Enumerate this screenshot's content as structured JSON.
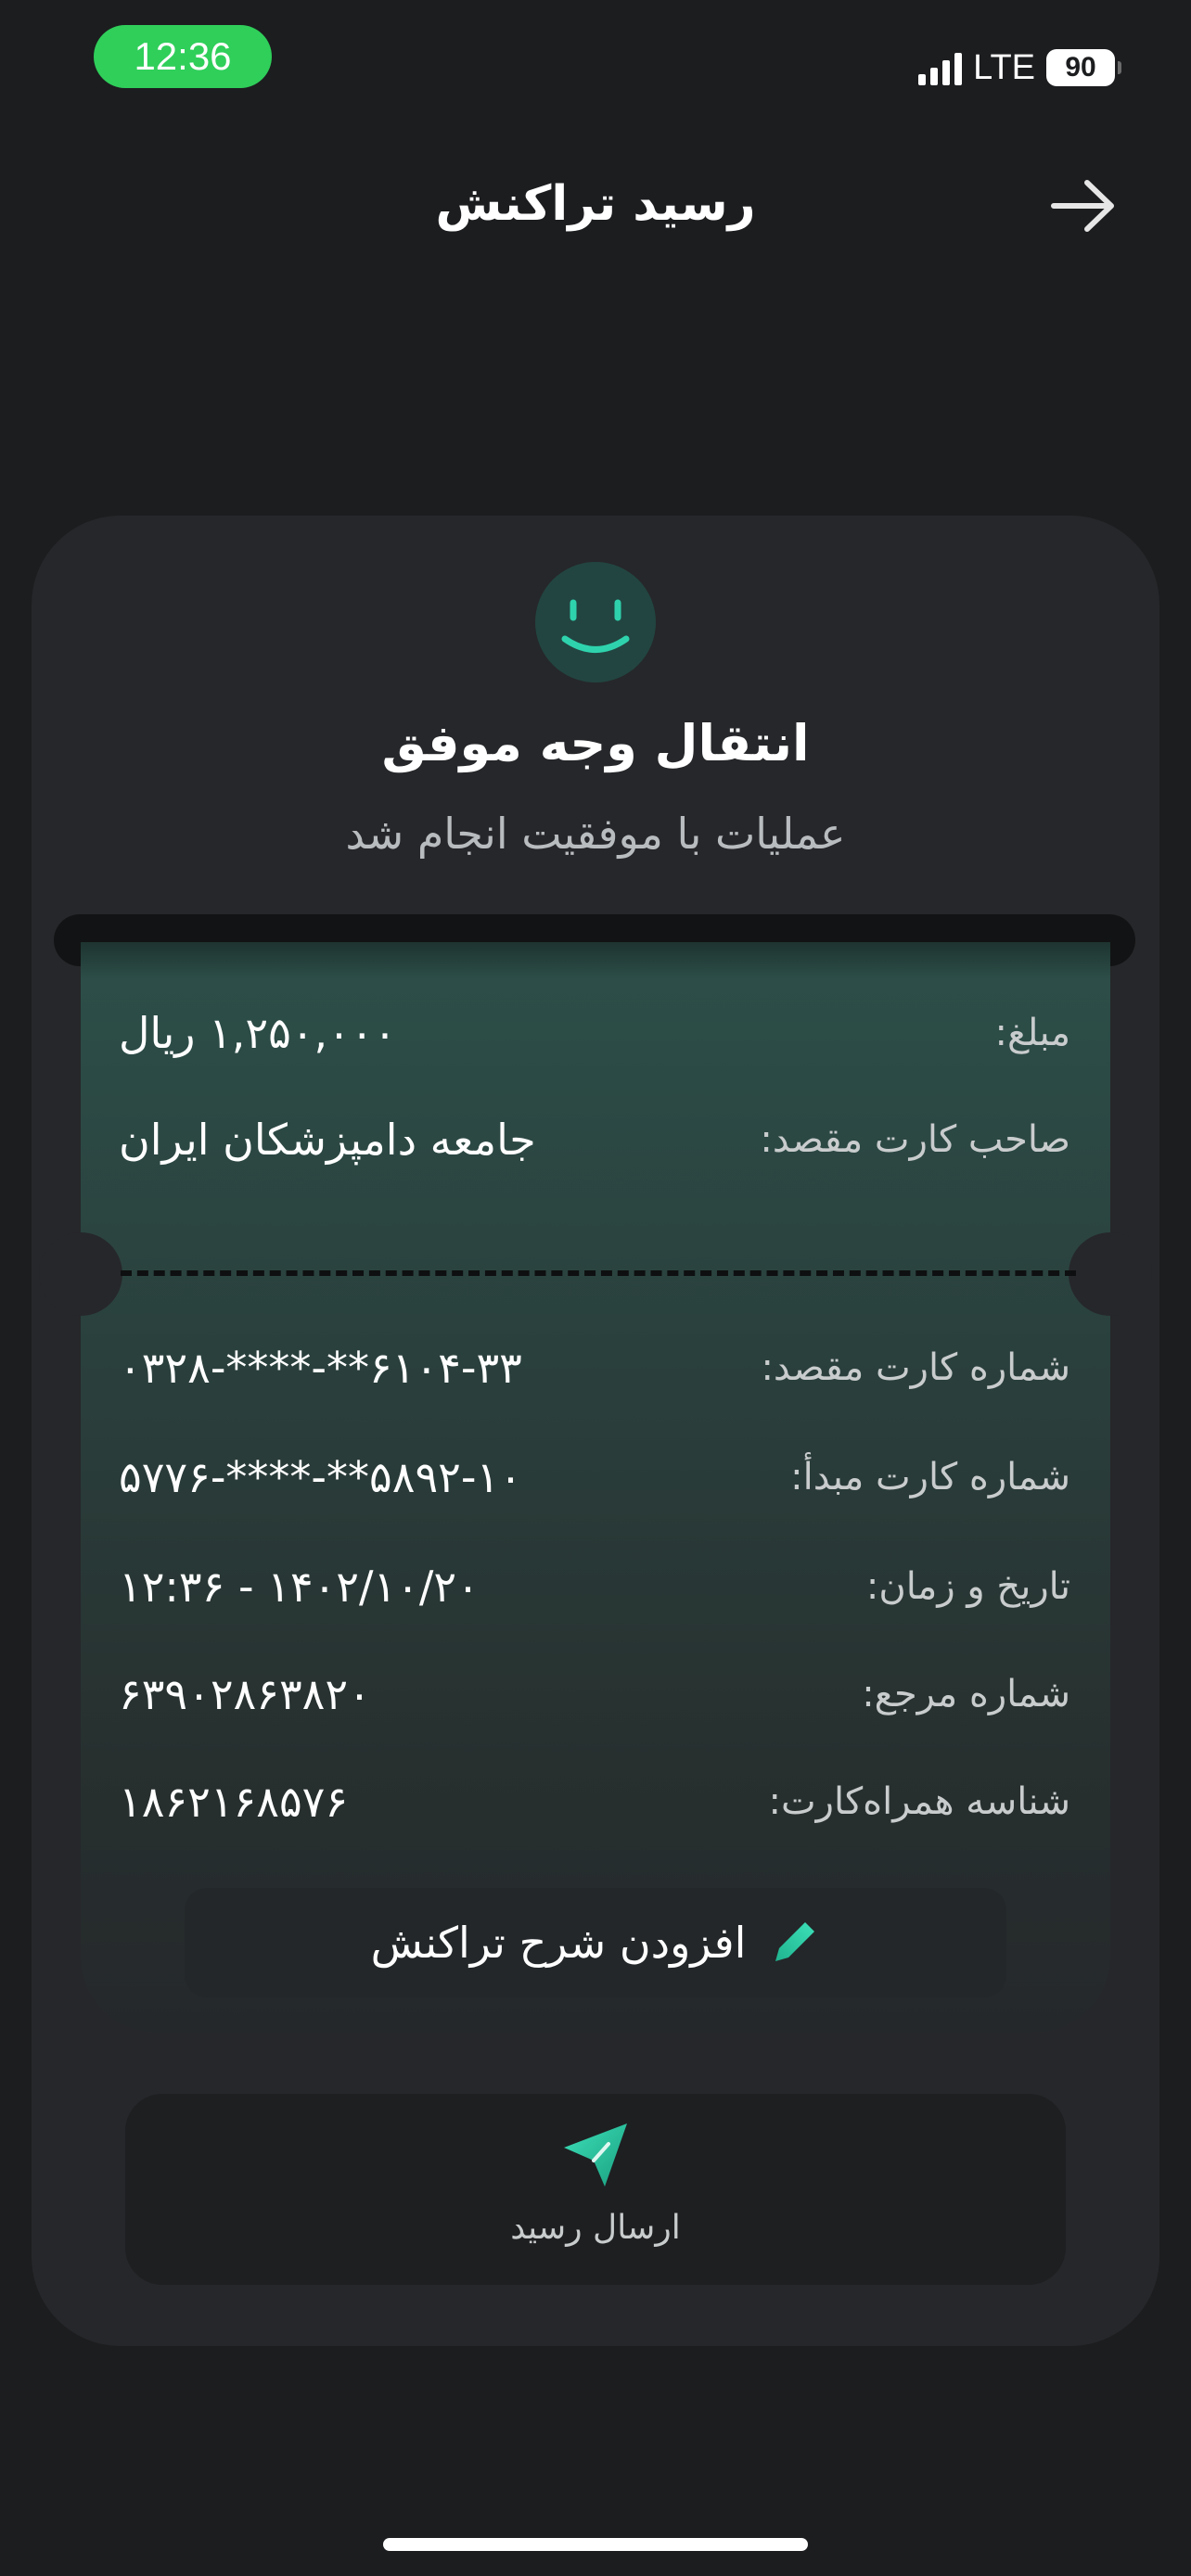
{
  "status_bar": {
    "time": "12:36",
    "network": "LTE",
    "battery": "90"
  },
  "header": {
    "title": "رسید تراکنش",
    "back_icon": "arrow-right-icon"
  },
  "result": {
    "icon": "smile-icon",
    "title": "انتقال وجه موفق",
    "subtitle": "عملیات با موفقیت انجام شد"
  },
  "receipt": {
    "top_fields": [
      {
        "label": "مبلغ:",
        "value": "۱,۲۵۰,۰۰۰ ریال"
      },
      {
        "label": "صاحب کارت مقصد:",
        "value": "جامعه دامپزشکان ایران"
      }
    ],
    "bottom_fields": [
      {
        "label": "شماره کارت مقصد:",
        "value": "۶۱۰۴-۳۳**-****-۰۳۲۸"
      },
      {
        "label": "شماره کارت مبدأ:",
        "value": "۵۸۹۲-۱۰**-****-۵۷۷۶"
      },
      {
        "label": "تاریخ و زمان:",
        "value": "۱۴۰۲/۱۰/۲۰ - ۱۲:۳۶"
      },
      {
        "label": "شماره مرجع:",
        "value": "۶۳۹۰۲۸۶۳۸۲۰"
      },
      {
        "label": "شناسه همراه‌کارت:",
        "value": "۱۸۶۲۱۶۸۵۷۶"
      }
    ],
    "add_note_label": "افزودن شرح تراکنش",
    "add_note_icon": "pencil-icon"
  },
  "send_receipt": {
    "label": "ارسال رسید",
    "icon": "paper-plane-icon"
  },
  "colors": {
    "background": "#1c1d1f",
    "accent": "#2ed3ad",
    "status_pill": "#2fcf5a"
  }
}
